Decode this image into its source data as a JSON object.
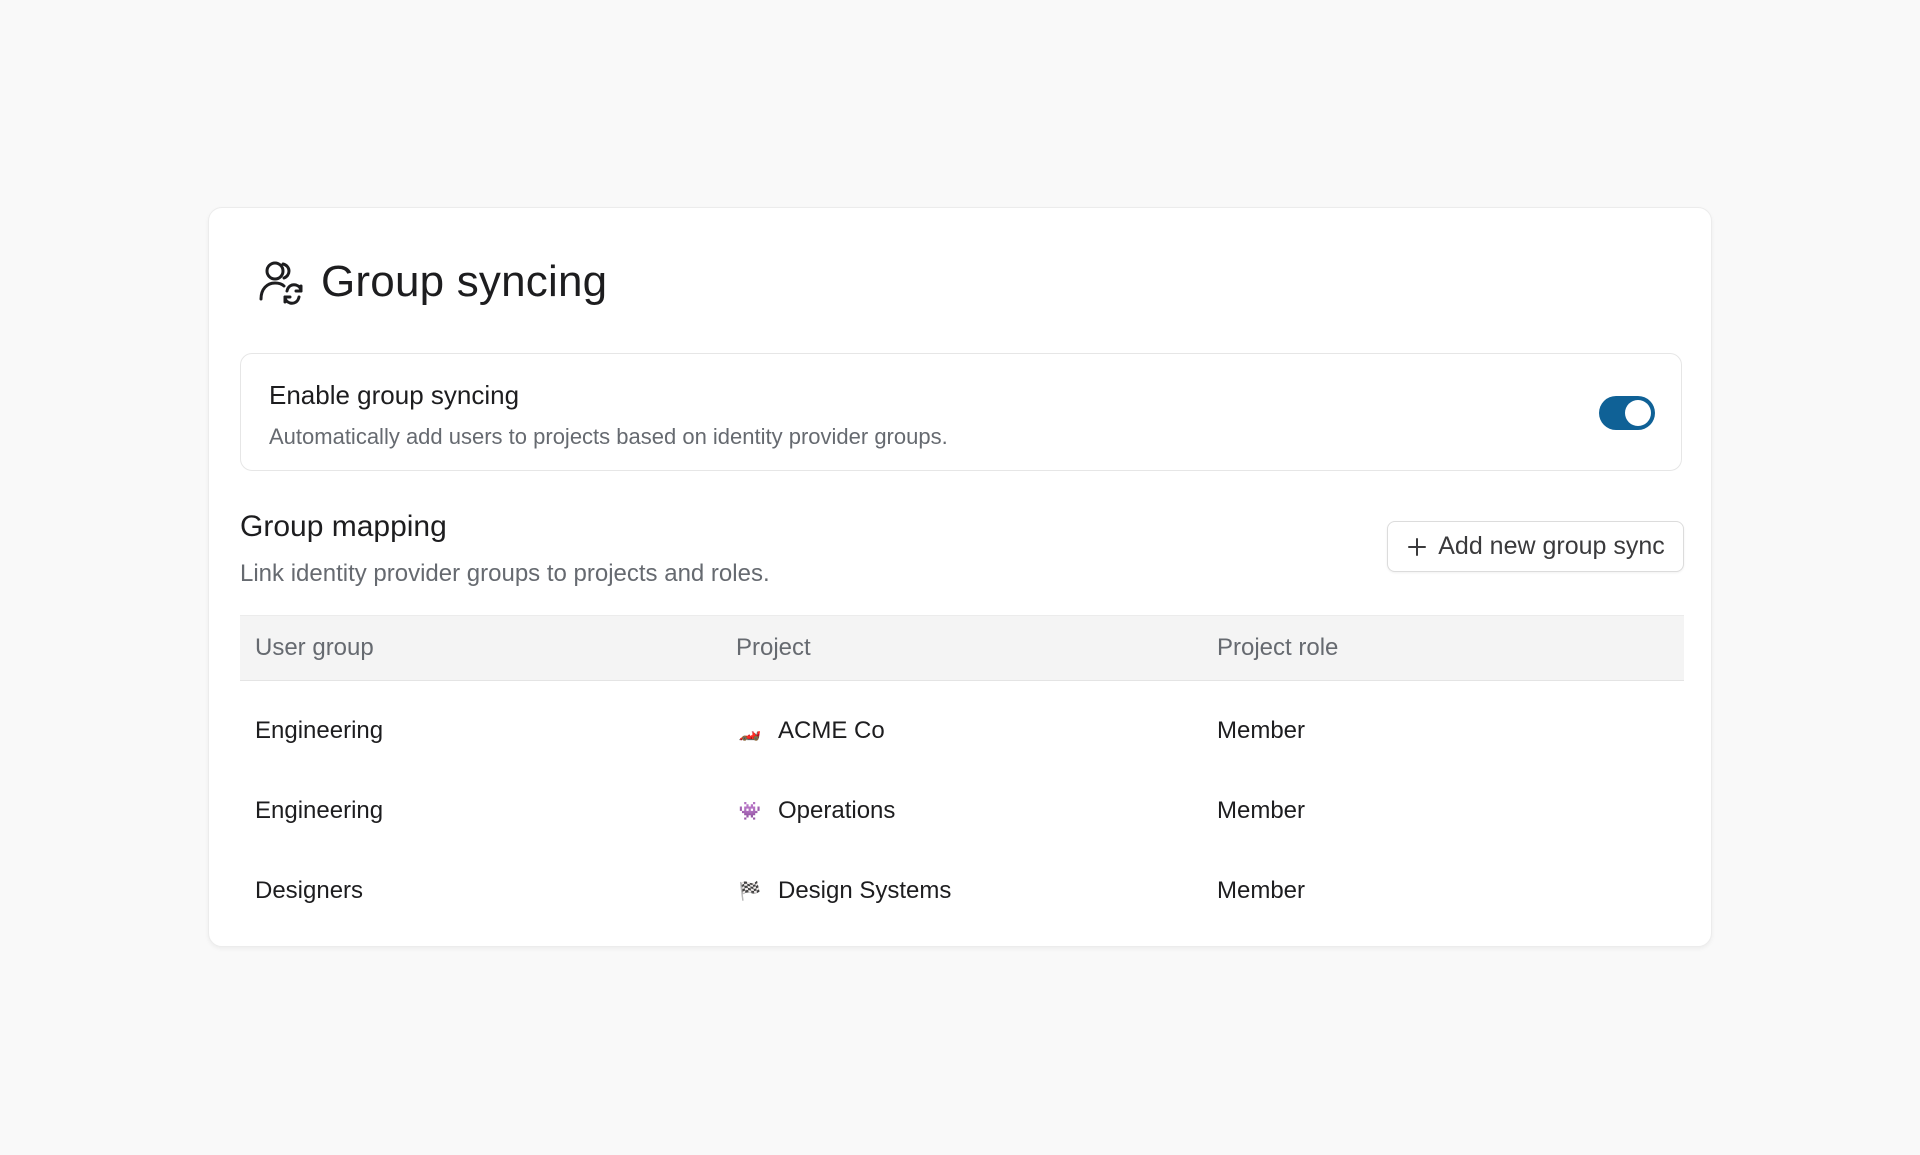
{
  "header": {
    "title": "Group syncing",
    "icon": "users-sync-icon"
  },
  "enable": {
    "title": "Enable group syncing",
    "description": "Automatically add users to projects based on identity provider groups.",
    "toggle_on": true,
    "toggle_color": "#0f6196"
  },
  "mapping": {
    "title": "Group mapping",
    "description": "Link identity provider groups to projects and roles.",
    "add_button_label": "Add new group sync"
  },
  "table": {
    "headers": [
      "User group",
      "Project",
      "Project role"
    ],
    "rows": [
      {
        "group": "Engineering",
        "project_emoji": "🏎️",
        "project": "ACME Co",
        "role": "Member"
      },
      {
        "group": "Engineering",
        "project_emoji": "👾",
        "project": "Operations",
        "role": "Member"
      },
      {
        "group": "Designers",
        "project_emoji": "🏁",
        "project": "Design Systems",
        "role": "Member"
      }
    ]
  }
}
